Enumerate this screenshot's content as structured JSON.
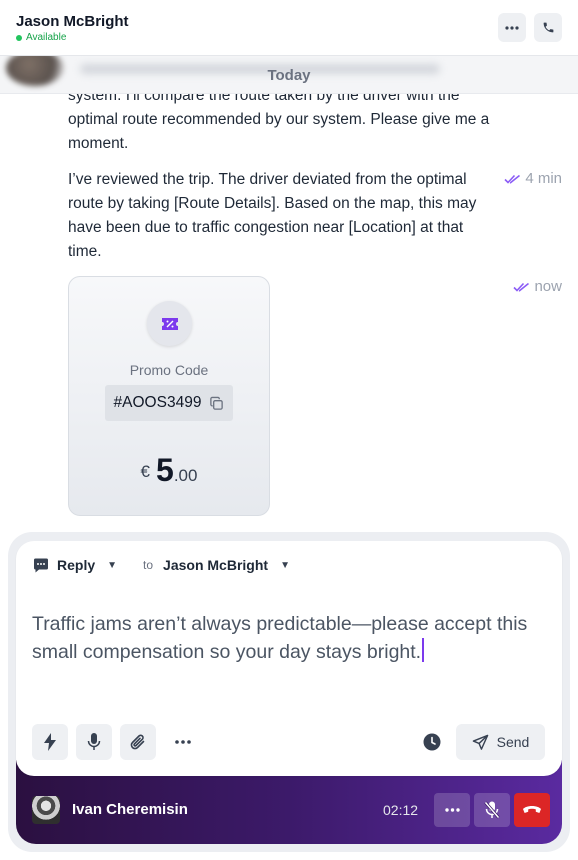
{
  "header": {
    "contact_name": "Jason McBright",
    "status": "Available"
  },
  "date_divider": "Today",
  "messages": [
    {
      "text": "system. I'll compare the route taken by the driver with the optimal route recommended by our system. Please give me a moment.",
      "time": ""
    },
    {
      "text": "I’ve reviewed the trip. The driver deviated from the optimal route by taking [Route Details]. Based on the map, this may have been due to traffic congestion near [Location] at that time.",
      "time": "4 min"
    }
  ],
  "promo": {
    "time": "now",
    "title": "Promo Code",
    "code": "#AOOS3499",
    "currency": "€",
    "amount_main": "5",
    "amount_cents": ".00"
  },
  "composer": {
    "reply_label": "Reply",
    "to_label": "to",
    "to_name": "Jason McBright",
    "text": "Traffic jams aren’t always predictable—please accept this small compensation so your day stays bright.",
    "send_label": "Send"
  },
  "call": {
    "caller_name": "Ivan Cheremisin",
    "duration": "02:12"
  },
  "colors": {
    "accent": "#7c3aed",
    "call_gradient_start": "#2b1040",
    "call_gradient_end": "#5a2aa0",
    "hangup": "#dc2626",
    "available": "#22c55e"
  }
}
